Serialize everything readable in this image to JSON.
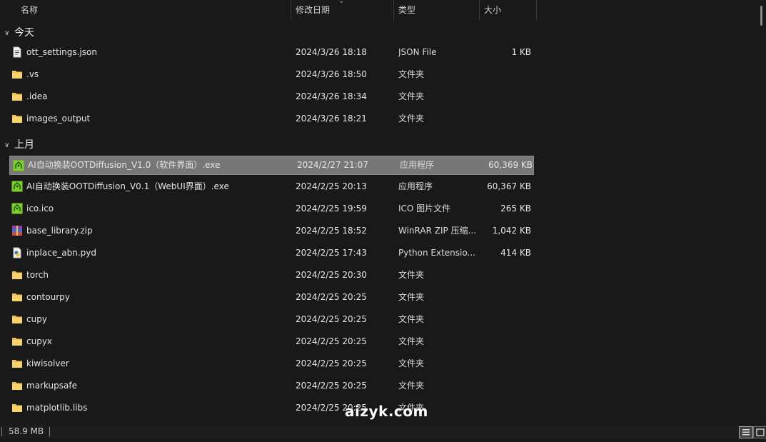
{
  "columns": {
    "name": "名称",
    "date": "修改日期",
    "type": "类型",
    "size": "大小"
  },
  "groups": [
    {
      "label": "今天",
      "rows": [
        {
          "name": "ott_settings.json",
          "date": "2024/3/26 18:18",
          "type": "JSON File",
          "size": "1 KB",
          "icon": "json-file-icon"
        },
        {
          "name": ".vs",
          "date": "2024/3/26 18:50",
          "type": "文件夹",
          "size": "",
          "icon": "folder-icon"
        },
        {
          "name": ".idea",
          "date": "2024/3/26 18:34",
          "type": "文件夹",
          "size": "",
          "icon": "folder-icon"
        },
        {
          "name": "images_output",
          "date": "2024/3/26 18:21",
          "type": "文件夹",
          "size": "",
          "icon": "folder-icon"
        }
      ]
    },
    {
      "label": "上月",
      "rows": [
        {
          "name": "AI自动换装OOTDiffusion_V1.0（软件界面）.exe",
          "date": "2024/2/27 21:07",
          "type": "应用程序",
          "size": "60,369 KB",
          "icon": "exe-app-icon",
          "selected": true
        },
        {
          "name": "AI自动换装OOTDiffusion_V0.1（WebUI界面）.exe",
          "date": "2024/2/25 20:13",
          "type": "应用程序",
          "size": "60,367 KB",
          "icon": "exe-app-icon"
        },
        {
          "name": "ico.ico",
          "date": "2024/2/25 19:59",
          "type": "ICO 图片文件",
          "size": "265 KB",
          "icon": "exe-app-icon"
        },
        {
          "name": "base_library.zip",
          "date": "2024/2/25 18:52",
          "type": "WinRAR ZIP 压缩...",
          "size": "1,042 KB",
          "icon": "winrar-zip-icon"
        },
        {
          "name": "inplace_abn.pyd",
          "date": "2024/2/25 17:43",
          "type": "Python Extensio...",
          "size": "414 KB",
          "icon": "python-extension-icon"
        },
        {
          "name": "torch",
          "date": "2024/2/25 20:30",
          "type": "文件夹",
          "size": "",
          "icon": "folder-icon"
        },
        {
          "name": "contourpy",
          "date": "2024/2/25 20:25",
          "type": "文件夹",
          "size": "",
          "icon": "folder-icon"
        },
        {
          "name": "cupy",
          "date": "2024/2/25 20:25",
          "type": "文件夹",
          "size": "",
          "icon": "folder-icon"
        },
        {
          "name": "cupyx",
          "date": "2024/2/25 20:25",
          "type": "文件夹",
          "size": "",
          "icon": "folder-icon"
        },
        {
          "name": "kiwisolver",
          "date": "2024/2/25 20:25",
          "type": "文件夹",
          "size": "",
          "icon": "folder-icon"
        },
        {
          "name": "markupsafe",
          "date": "2024/2/25 20:25",
          "type": "文件夹",
          "size": "",
          "icon": "folder-icon"
        },
        {
          "name": "matplotlib.libs",
          "date": "2024/2/25 20:25",
          "type": "文件夹",
          "size": "",
          "icon": "folder-icon"
        }
      ]
    }
  ],
  "status": {
    "size": "58.9 MB"
  },
  "watermark": "aizyk.com",
  "colors": {
    "background": "#191919",
    "selected_row": "#777777",
    "folder": "#f2c14e",
    "app_icon": "#7ccf2a"
  }
}
